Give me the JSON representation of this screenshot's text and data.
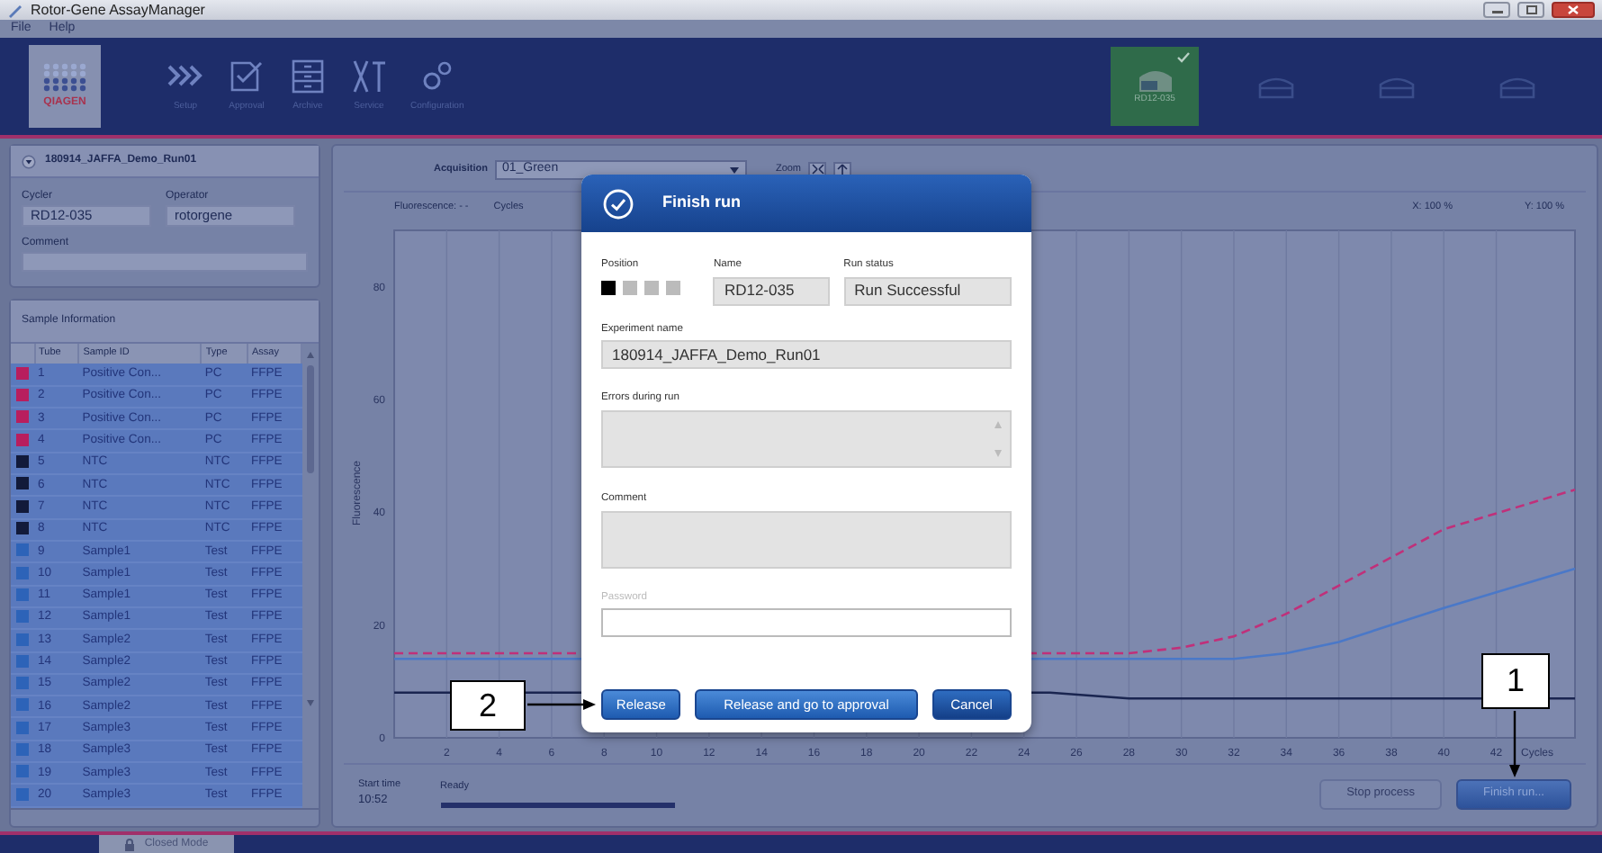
{
  "window": {
    "title": "Rotor-Gene AssayManager"
  },
  "menu": [
    "File",
    "Help"
  ],
  "toolbar": {
    "logo": "QIAGEN",
    "items": [
      {
        "label": "Setup",
        "kind": "setup"
      },
      {
        "label": "Approval",
        "kind": "approval"
      },
      {
        "label": "Archive",
        "kind": "archive"
      },
      {
        "label": "Service",
        "kind": "service"
      },
      {
        "label": "Configuration",
        "kind": "configuration"
      }
    ],
    "cyclers": [
      {
        "label": "RD12-035",
        "selected": true
      },
      {
        "selected": false
      },
      {
        "selected": false
      },
      {
        "selected": false
      }
    ]
  },
  "run_panel": {
    "title": "180914_JAFFA_Demo_Run01",
    "cycler_label": "Cycler",
    "cycler": "RD12-035",
    "operator_label": "Operator",
    "operator": "rotorgene",
    "comment_label": "Comment"
  },
  "samples": {
    "title": "Sample Information",
    "columns": [
      "Tube",
      "Sample ID",
      "Type",
      "Assay"
    ],
    "rows": [
      {
        "color": "#b81e5e",
        "tube": "1",
        "sample_id": "Positive Con...",
        "type": "PC",
        "assay": "FFPE"
      },
      {
        "color": "#b81e5e",
        "tube": "2",
        "sample_id": "Positive Con...",
        "type": "PC",
        "assay": "FFPE"
      },
      {
        "color": "#b81e5e",
        "tube": "3",
        "sample_id": "Positive Con...",
        "type": "PC",
        "assay": "FFPE"
      },
      {
        "color": "#b81e5e",
        "tube": "4",
        "sample_id": "Positive Con...",
        "type": "PC",
        "assay": "FFPE"
      },
      {
        "color": "#121a3a",
        "tube": "5",
        "sample_id": "NTC",
        "type": "NTC",
        "assay": "FFPE"
      },
      {
        "color": "#121a3a",
        "tube": "6",
        "sample_id": "NTC",
        "type": "NTC",
        "assay": "FFPE"
      },
      {
        "color": "#121a3a",
        "tube": "7",
        "sample_id": "NTC",
        "type": "NTC",
        "assay": "FFPE"
      },
      {
        "color": "#121a3a",
        "tube": "8",
        "sample_id": "NTC",
        "type": "NTC",
        "assay": "FFPE"
      },
      {
        "color": "#2d63b8",
        "tube": "9",
        "sample_id": "Sample1",
        "type": "Test",
        "assay": "FFPE"
      },
      {
        "color": "#2d63b8",
        "tube": "10",
        "sample_id": "Sample1",
        "type": "Test",
        "assay": "FFPE"
      },
      {
        "color": "#2d63b8",
        "tube": "11",
        "sample_id": "Sample1",
        "type": "Test",
        "assay": "FFPE"
      },
      {
        "color": "#2d63b8",
        "tube": "12",
        "sample_id": "Sample1",
        "type": "Test",
        "assay": "FFPE"
      },
      {
        "color": "#2d63b8",
        "tube": "13",
        "sample_id": "Sample2",
        "type": "Test",
        "assay": "FFPE"
      },
      {
        "color": "#2d63b8",
        "tube": "14",
        "sample_id": "Sample2",
        "type": "Test",
        "assay": "FFPE"
      },
      {
        "color": "#2d63b8",
        "tube": "15",
        "sample_id": "Sample2",
        "type": "Test",
        "assay": "FFPE"
      },
      {
        "color": "#2d63b8",
        "tube": "16",
        "sample_id": "Sample2",
        "type": "Test",
        "assay": "FFPE"
      },
      {
        "color": "#2d63b8",
        "tube": "17",
        "sample_id": "Sample3",
        "type": "Test",
        "assay": "FFPE"
      },
      {
        "color": "#2d63b8",
        "tube": "18",
        "sample_id": "Sample3",
        "type": "Test",
        "assay": "FFPE"
      },
      {
        "color": "#2d63b8",
        "tube": "19",
        "sample_id": "Sample3",
        "type": "Test",
        "assay": "FFPE"
      },
      {
        "color": "#2d63b8",
        "tube": "20",
        "sample_id": "Sample3",
        "type": "Test",
        "assay": "FFPE"
      }
    ]
  },
  "chart_panel": {
    "acquisition_label": "Acquisition",
    "acquisition": "01_Green",
    "zoom_label": "Zoom",
    "fluorescence": "Fluorescence: - -",
    "cycles": "Cycles",
    "x_zoom": "X: 100 %",
    "y_zoom": "Y: 100 %",
    "chart_data": {
      "type": "line",
      "xlabel": "Cycles",
      "ylabel": "Fluorescence",
      "x": [
        0,
        6,
        25,
        28,
        30,
        32,
        34,
        36,
        38,
        40,
        45
      ],
      "series": [
        {
          "color": "#c0307a",
          "line_style": "dashed",
          "values": [
            15,
            15,
            15,
            15,
            16,
            18,
            22,
            27,
            32,
            37,
            44
          ]
        },
        {
          "color": "#4a78c8",
          "line_style": "solid",
          "values": [
            14,
            14,
            14,
            14,
            14,
            14,
            15,
            17,
            20,
            23,
            30
          ]
        },
        {
          "color": "#1a2550",
          "line_style": "solid",
          "values": [
            8,
            8,
            8,
            7,
            7,
            7,
            7,
            7,
            7,
            7,
            7
          ]
        }
      ],
      "grid": true,
      "xlim": [
        0,
        45
      ],
      "ylim": [
        0,
        90
      ],
      "xticks": [
        2,
        4,
        6,
        8,
        10,
        12,
        14,
        16,
        18,
        20,
        22,
        24,
        26,
        28,
        30,
        32,
        34,
        36,
        38,
        40,
        42
      ],
      "yticks": [
        0,
        20,
        40,
        60,
        80
      ]
    }
  },
  "run_status": {
    "start_time_label": "Start time",
    "start_time": "10:52",
    "state": "Ready",
    "level": 1,
    "buttons": [
      {
        "label": "Stop process",
        "disabled": true
      },
      {
        "label": "Finish run...",
        "disabled": false
      }
    ]
  },
  "dialog": {
    "title": "Finish run",
    "position_label": "Position",
    "positions": [
      {
        "selected": true
      },
      {
        "selected": false
      },
      {
        "selected": false
      },
      {
        "selected": false
      }
    ],
    "name_label": "Name",
    "name": "RD12-035",
    "status_label": "Run status",
    "status": "Run Successful",
    "experiment_label": "Experiment name",
    "experiment": "180914_JAFFA_Demo_Run01",
    "errors_label": "Errors during run",
    "comment_label": "Comment",
    "password_label": "Password",
    "buttons": [
      "Release",
      "Release and go to approval",
      "Cancel"
    ]
  },
  "callouts": [
    "2",
    "1"
  ],
  "status_bar": {
    "mode": "Closed Mode"
  }
}
